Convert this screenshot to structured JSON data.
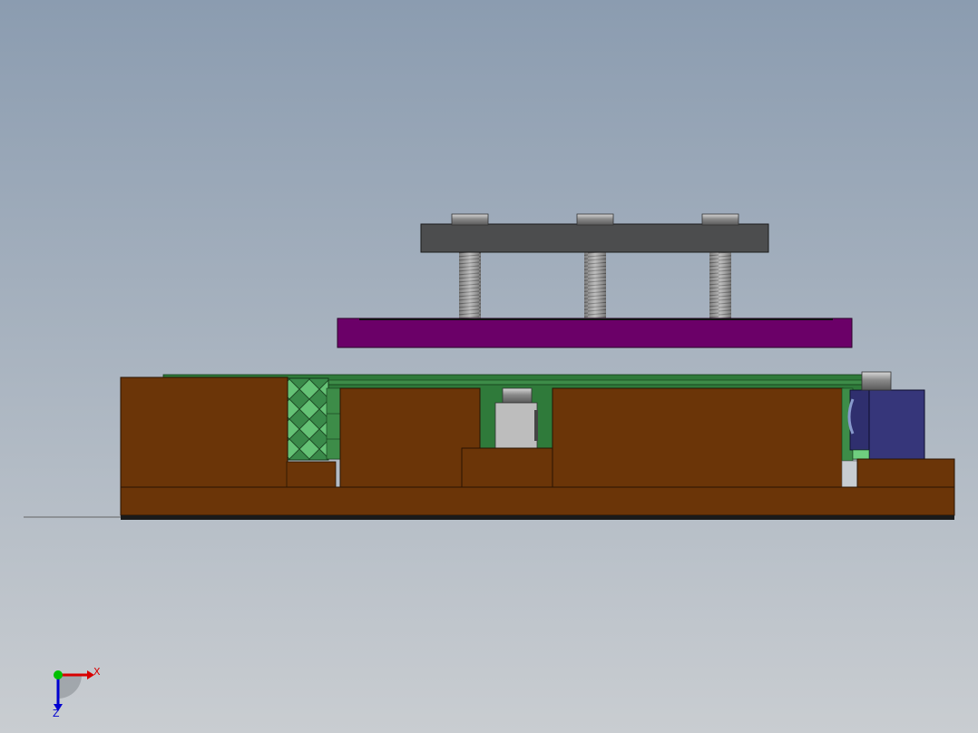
{
  "viewport": {
    "background_top": "#8b9cb0",
    "background_bottom": "#c9cdd1"
  },
  "parts": {
    "top_plate": {
      "color": "#4c4d4e"
    },
    "caps": {
      "color": "#8a8a8a"
    },
    "bolts": {
      "color": "#a4a4a4"
    },
    "purple_plate": {
      "color": "#6b0068"
    },
    "brown_blocks": {
      "color": "#6b3508"
    },
    "green_parts": {
      "color": "#2f7a3a"
    },
    "green_light": {
      "color": "#6fcf7f"
    },
    "grey_block": {
      "color": "#bdbdbd"
    },
    "blue_block": {
      "color": "#2f2f6e"
    }
  },
  "triad": {
    "x_label": "X",
    "z_label": "Z",
    "x_color": "#d80000",
    "y_color": "#00c000",
    "z_color": "#0000d0"
  }
}
